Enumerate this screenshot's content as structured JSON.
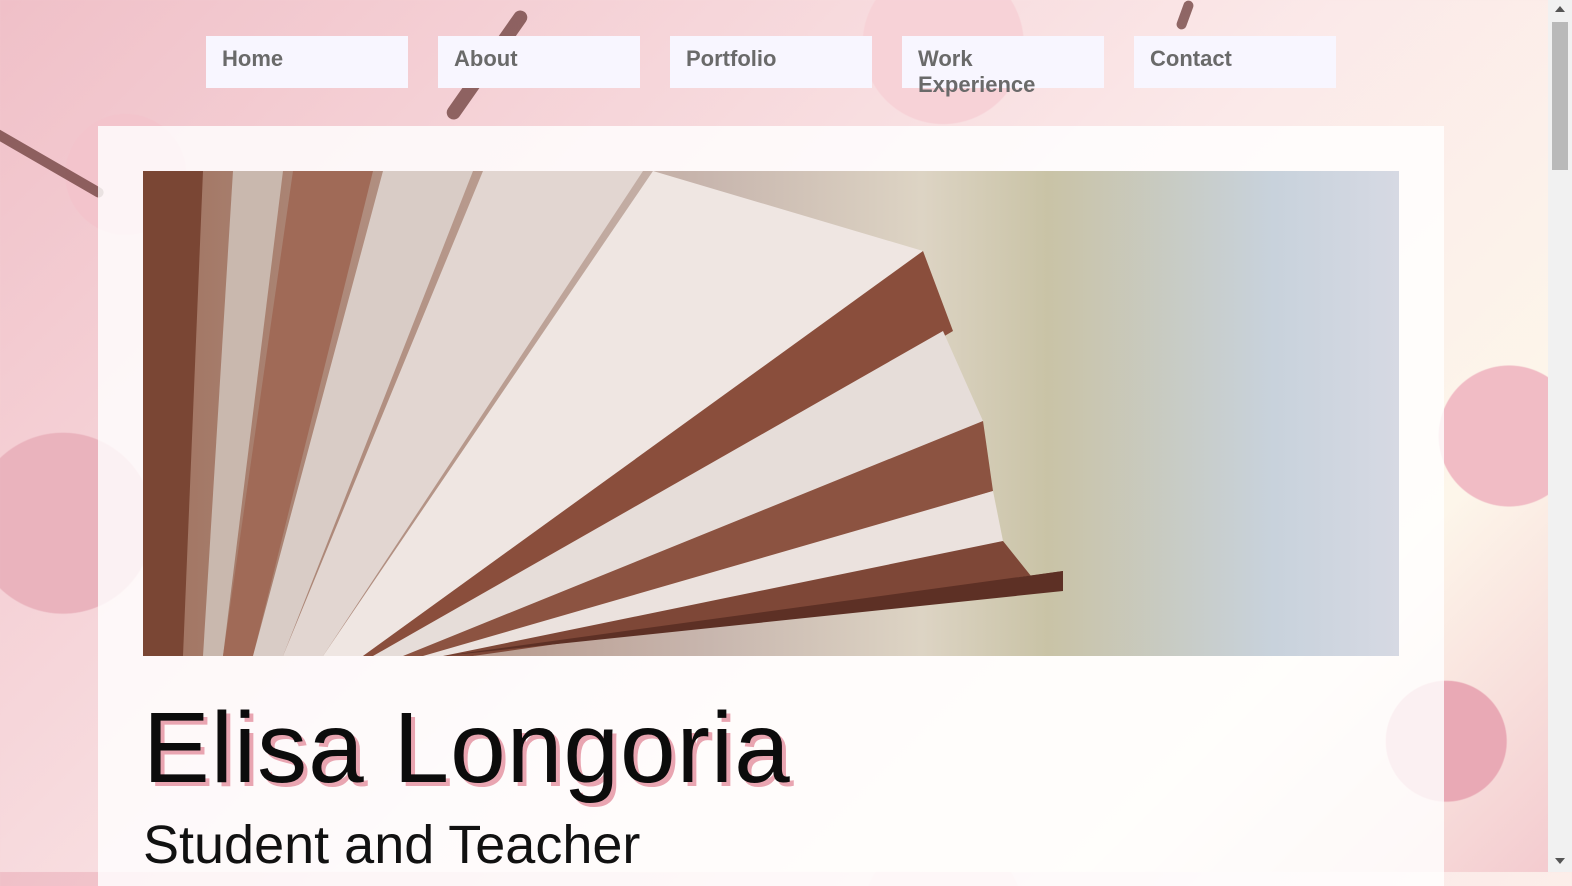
{
  "nav": {
    "items": [
      {
        "label": "Home"
      },
      {
        "label": "About"
      },
      {
        "label": "Portfolio"
      },
      {
        "label": "Work Experience"
      },
      {
        "label": "Contact"
      }
    ]
  },
  "hero": {
    "image": "open-book-photo",
    "name": "Elisa Longoria",
    "subtitle": "Student and Teacher"
  },
  "colors": {
    "nav_background": "#f8f6ff",
    "nav_text": "#6a6a6a",
    "name_shadow": "#e9a5b1",
    "card_background": "#ffffff"
  }
}
